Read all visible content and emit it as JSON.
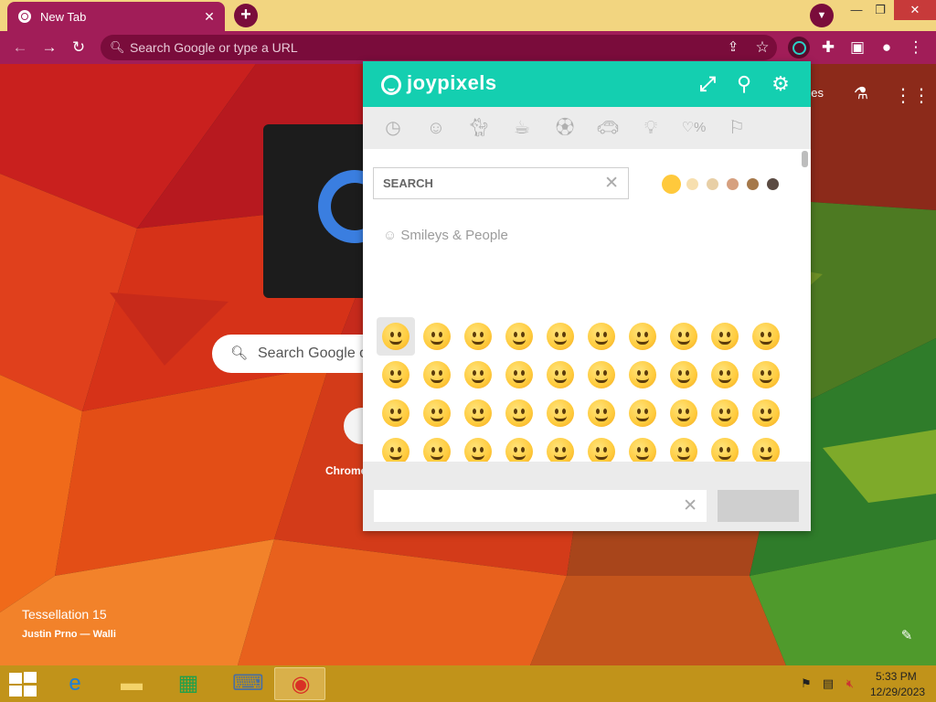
{
  "browser": {
    "tab_title": "New Tab",
    "omnibox_placeholder": "Search Google or type a URL",
    "accent": "#a11d58",
    "tabstrip_color": "#f2d580"
  },
  "ntp": {
    "search_placeholder": "Search Google o",
    "shortcut_label": "Chrome",
    "images_link": "ges",
    "wallpaper_title": "Tessellation 15",
    "wallpaper_credit": "Justin Prno — Walli"
  },
  "joypixels": {
    "brand": "joypixels",
    "header_color": "#14cfb0",
    "search_placeholder": "SEARCH",
    "section_title": "Smileys & People",
    "categories": [
      "recent-icon",
      "smileys-icon",
      "animals-icon",
      "food-icon",
      "activity-icon",
      "travel-icon",
      "objects-icon",
      "symbols-icon",
      "flags-icon"
    ],
    "skin_tones": [
      "#ffc93c",
      "#f7dfae",
      "#e8cfa6",
      "#d6a07f",
      "#a5784a",
      "#5a4a42"
    ]
  },
  "taskbar": {
    "time": "5:33 PM",
    "date": "12/29/2023"
  }
}
